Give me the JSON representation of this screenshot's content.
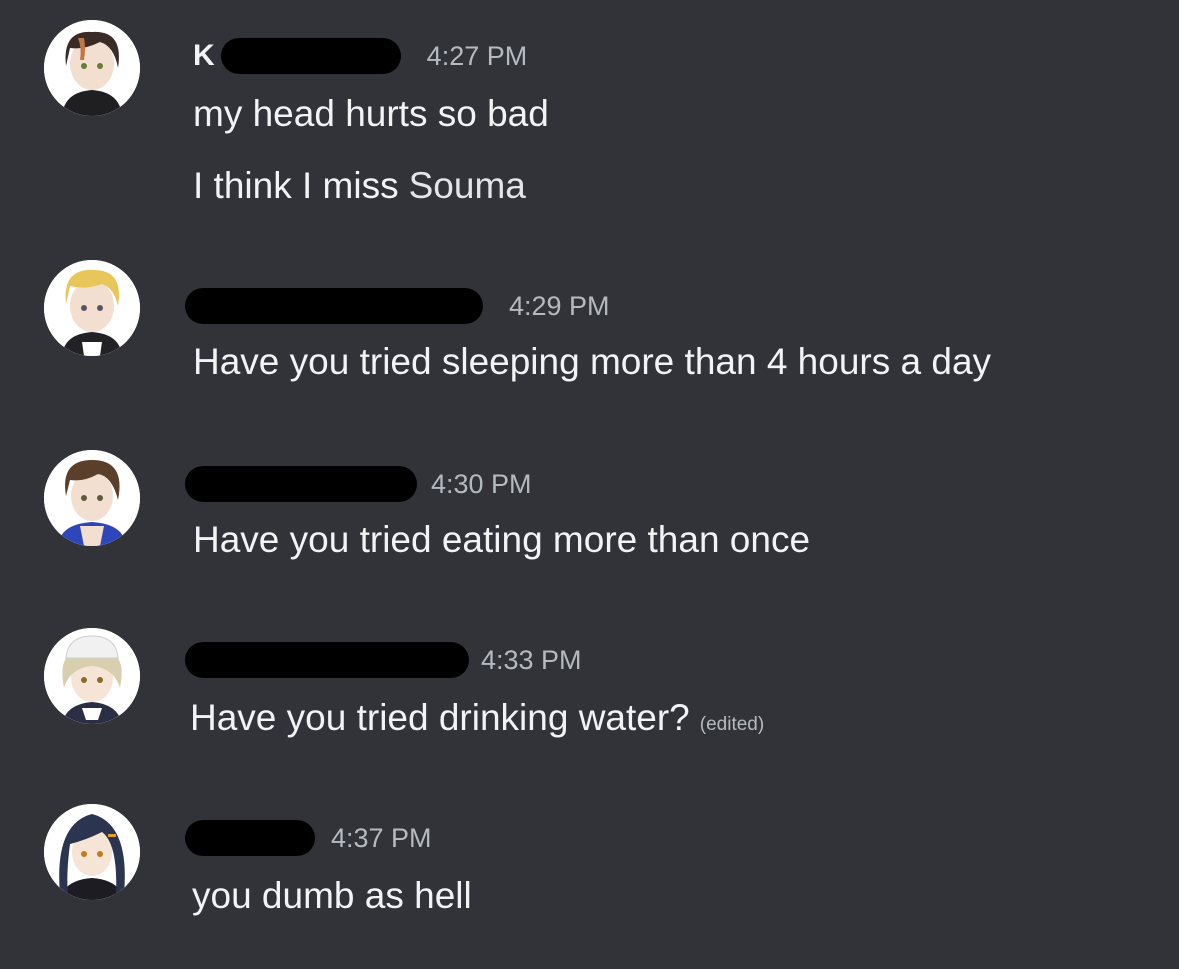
{
  "messages": [
    {
      "author_visible": "K",
      "time": "4:27 PM",
      "lines": [
        "my head hurts so bad",
        "I think I miss"
      ],
      "mention": "Souma"
    },
    {
      "author_visible": "",
      "time": "4:29 PM",
      "lines": [
        "Have you tried sleeping more than 4 hours a day"
      ]
    },
    {
      "author_visible": "",
      "time": "4:30 PM",
      "lines": [
        "Have you tried eating more than once"
      ]
    },
    {
      "author_visible": "",
      "time": "4:33 PM",
      "lines": [
        "Have you tried drinking water?"
      ],
      "edited": "(edited)"
    },
    {
      "author_visible": "",
      "time": "4:37 PM",
      "lines": [
        "you dumb as hell"
      ]
    }
  ],
  "colors": {
    "background": "#313338",
    "text": "#f2f3f5",
    "timestamp": "#b5bac1",
    "redaction": "#000000"
  },
  "icons": [
    "avatar-1",
    "avatar-2",
    "avatar-3",
    "avatar-4",
    "avatar-5"
  ]
}
